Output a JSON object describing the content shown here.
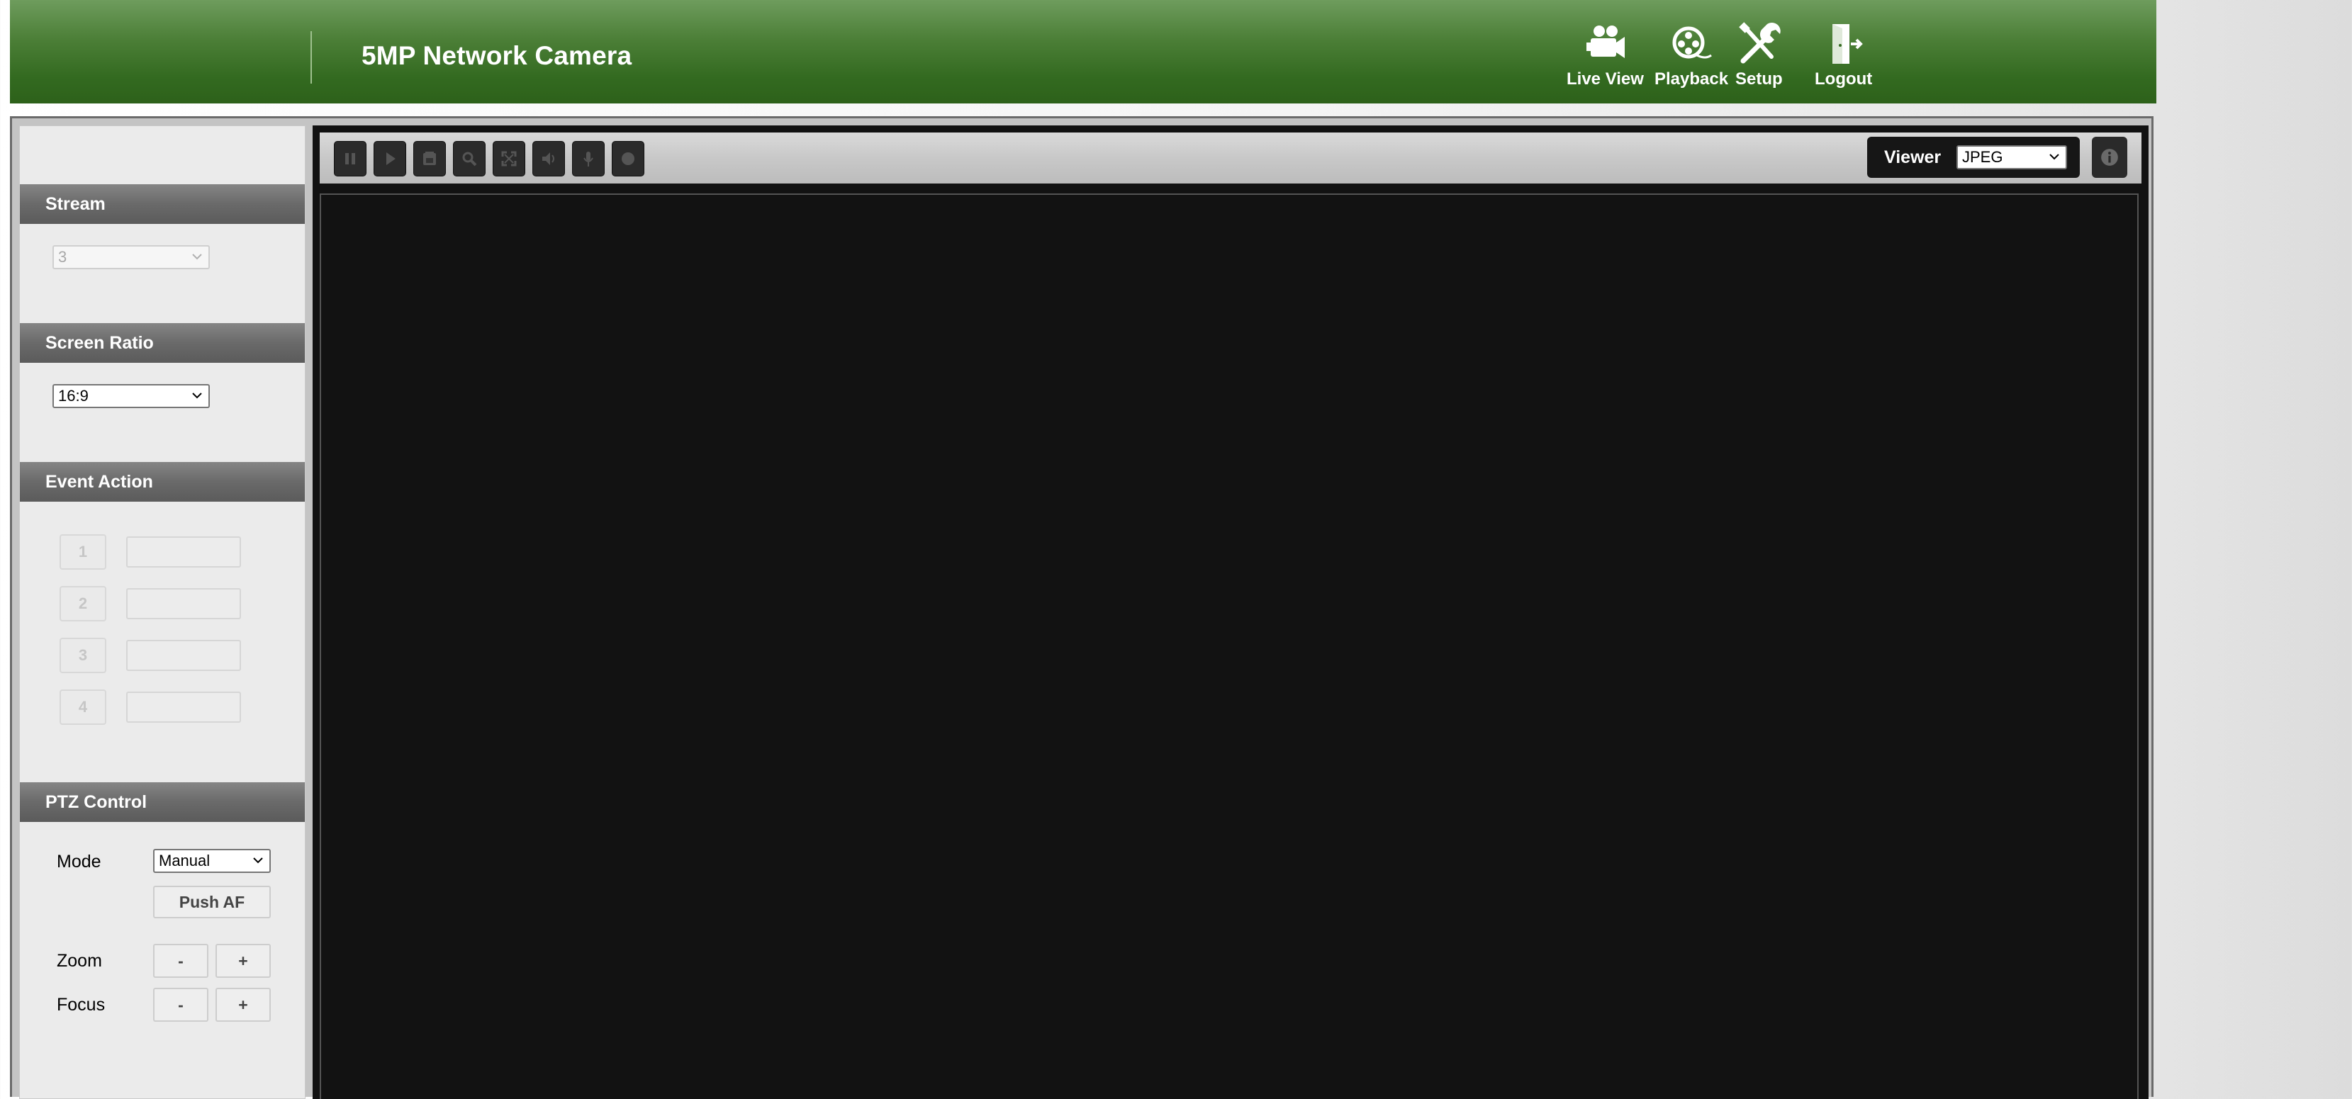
{
  "header": {
    "title": "5MP Network Camera",
    "nav": [
      {
        "label": "Live View",
        "icon": "video-camera-icon"
      },
      {
        "label": "Playback",
        "icon": "film-reel-icon"
      },
      {
        "label": "Setup",
        "icon": "tools-icon"
      },
      {
        "label": "Logout",
        "icon": "door-exit-icon"
      }
    ]
  },
  "sidebar": {
    "stream": {
      "title": "Stream",
      "value": "3"
    },
    "screen_ratio": {
      "title": "Screen Ratio",
      "value": "16:9"
    },
    "event_action": {
      "title": "Event Action",
      "items": [
        "1",
        "2",
        "3",
        "4"
      ]
    },
    "ptz": {
      "title": "PTZ Control",
      "mode_label": "Mode",
      "mode_value": "Manual",
      "push_af_label": "Push AF",
      "zoom_label": "Zoom",
      "focus_label": "Focus",
      "minus": "-",
      "plus": "+"
    }
  },
  "viewer": {
    "label": "Viewer",
    "value": "JPEG",
    "toolbar_icons": [
      "pause-icon",
      "play-icon",
      "snapshot-icon",
      "zoom-icon",
      "fullscreen-icon",
      "speaker-icon",
      "microphone-icon",
      "record-icon"
    ]
  },
  "colors": {
    "header_green": "#336a20",
    "section_gray": "#6a6a6a",
    "video_bg": "#121212"
  }
}
